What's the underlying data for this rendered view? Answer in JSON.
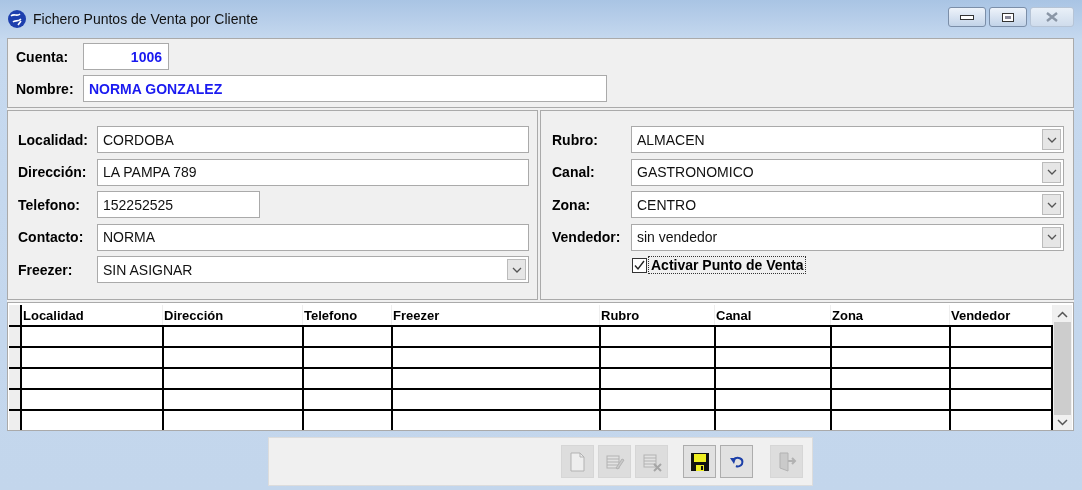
{
  "window": {
    "title": "Fichero Puntos de Venta por Cliente"
  },
  "header": {
    "fields": [
      {
        "label": "Cuenta:",
        "value": "1006",
        "kind": "number"
      },
      {
        "label": "Nombre:",
        "value": "NORMA GONZALEZ",
        "kind": "text"
      }
    ]
  },
  "left_panel": {
    "fields": [
      {
        "label": "Localidad:",
        "value": "CORDOBA",
        "kind": "text"
      },
      {
        "label": "Dirección:",
        "value": "LA PAMPA 789",
        "kind": "text"
      },
      {
        "label": "Telefono:",
        "value": "152252525",
        "kind": "text"
      },
      {
        "label": "Contacto:",
        "value": "NORMA",
        "kind": "text"
      },
      {
        "label": "Freezer:",
        "value": "SIN ASIGNAR",
        "kind": "select"
      }
    ]
  },
  "right_panel": {
    "fields": [
      {
        "label": "Rubro:",
        "value": "ALMACEN",
        "kind": "select"
      },
      {
        "label": "Canal:",
        "value": "GASTRONOMICO",
        "kind": "select"
      },
      {
        "label": "Zona:",
        "value": "CENTRO",
        "kind": "select"
      },
      {
        "label": "Vendedor:",
        "value": "sin vendedor",
        "kind": "select"
      }
    ],
    "checkbox": {
      "label": "Activar Punto de Venta",
      "checked": true
    }
  },
  "table": {
    "columns": [
      "Localidad",
      "Dirección",
      "Telefono",
      "Freezer",
      "Rubro",
      "Canal",
      "Zona",
      "Vendedor"
    ]
  },
  "toolbar": {
    "buttons": [
      {
        "kind": "new",
        "disabled": true
      },
      {
        "kind": "edit",
        "disabled": true
      },
      {
        "kind": "delete",
        "disabled": true
      },
      {
        "kind": "save",
        "disabled": false
      },
      {
        "kind": "undo",
        "disabled": false
      },
      {
        "kind": "exit",
        "disabled": true
      }
    ]
  }
}
